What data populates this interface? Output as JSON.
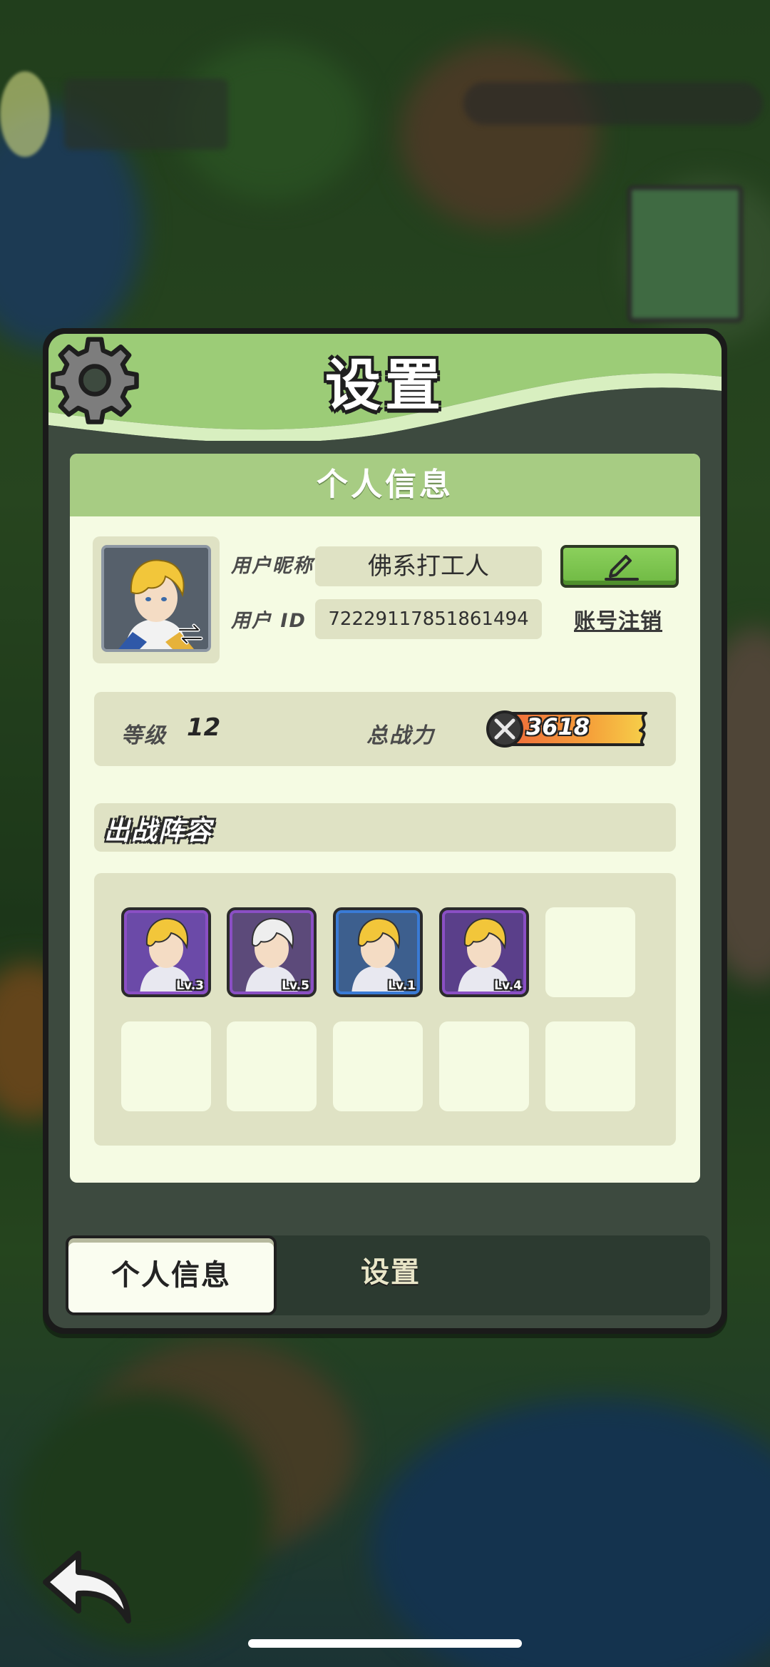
{
  "panel": {
    "title": "设置",
    "section_title": "个人信息"
  },
  "profile": {
    "nickname_label": "用户昵称",
    "nickname": "佛系打工人",
    "id_label": "用户 ID",
    "user_id": "7222911785186149​4",
    "deregister_label": "账号注销",
    "edit_icon": "pencil-icon",
    "swap_icon": "swap-arrows-icon"
  },
  "stats": {
    "level_label": "等级",
    "level": "12",
    "power_label": "总战力",
    "power": "3618",
    "power_icon": "crossed-swords-icon"
  },
  "lineup": {
    "title": "出战阵容",
    "heroes": [
      {
        "level": "Lv.3",
        "frame": "#8a4fc4",
        "bg": "#6b4aa8"
      },
      {
        "level": "Lv.5",
        "frame": "#8a4fc4",
        "bg": "#5c4a7a"
      },
      {
        "level": "Lv.1",
        "frame": "#3a7bd5",
        "bg": "#3d5f8e"
      },
      {
        "level": "Lv.4",
        "frame": "#8a4fc4",
        "bg": "#5a3f8a"
      }
    ],
    "empty_slots": 6
  },
  "tabs": {
    "active": "个人信息",
    "inactive": "设置"
  },
  "colors": {
    "header_green": "#a7cc83",
    "card_bg": "#f5fbe3",
    "edit_green": "#6fb943",
    "power_orange": "#f0793a"
  }
}
